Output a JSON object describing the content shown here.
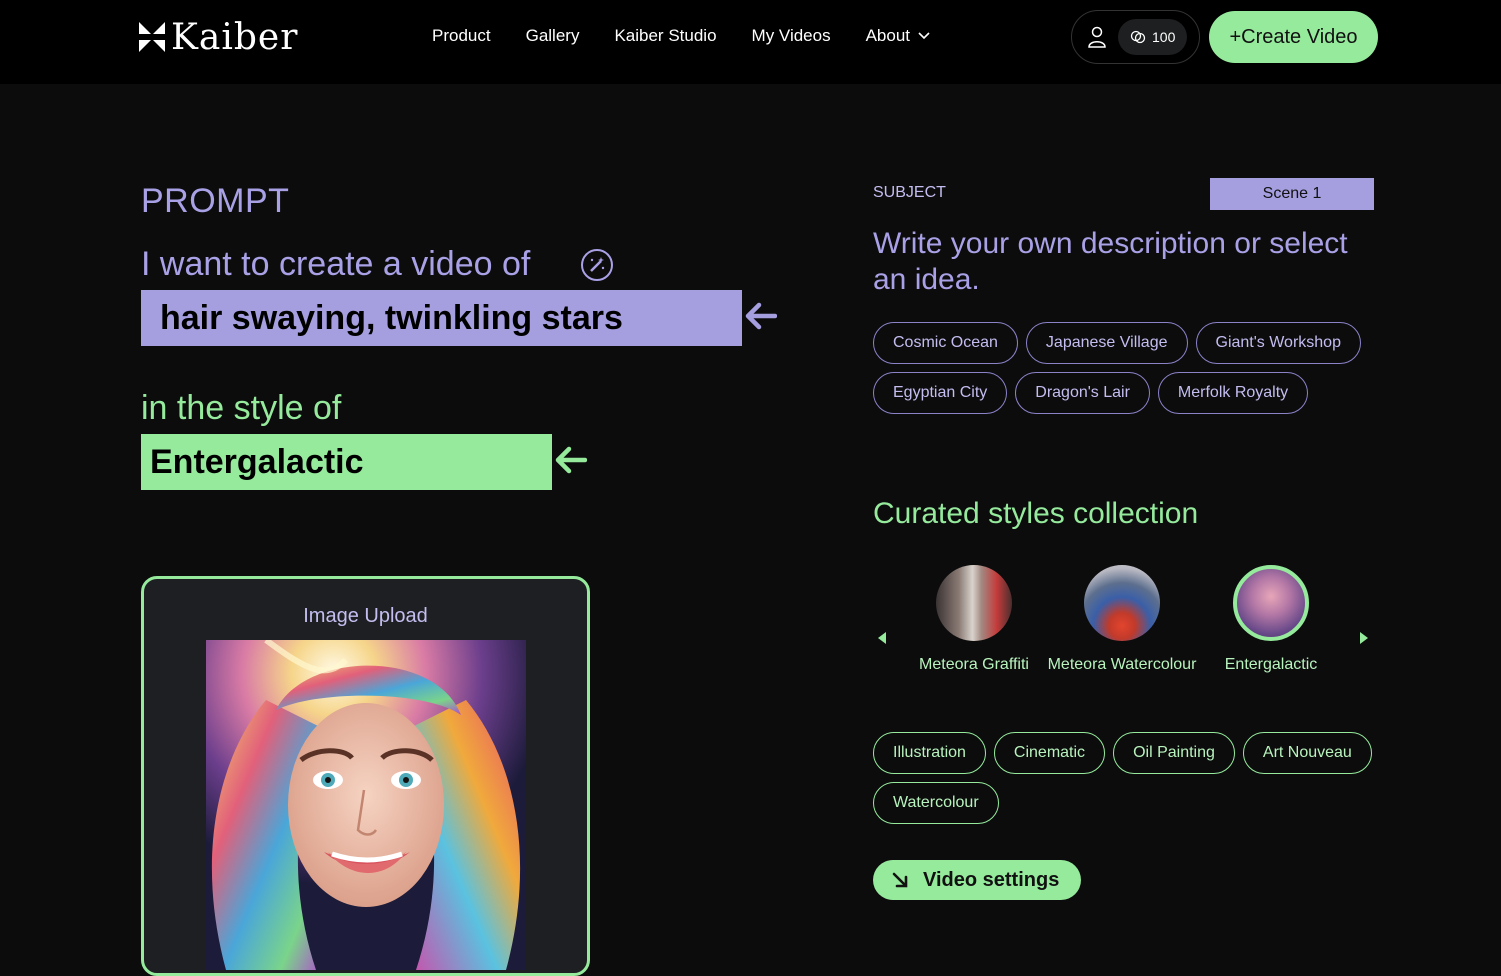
{
  "app": {
    "brand": "Kaiber",
    "accent_green": "#95ea9c",
    "accent_purple": "#a59fe0"
  },
  "nav": {
    "items": [
      "Product",
      "Gallery",
      "Kaiber Studio",
      "My Videos",
      "About"
    ],
    "credits": "100",
    "create_label": "+Create Video"
  },
  "prompt": {
    "heading": "PROMPT",
    "intro": "I want to create a video of",
    "subject_value": "hair swaying, twinkling stars",
    "style_intro": "in the style of",
    "style_value": "Entergalactic"
  },
  "upload": {
    "title": "Image Upload"
  },
  "subject_panel": {
    "label": "SUBJECT",
    "scene": "Scene 1",
    "instruction": "Write your own description or select an idea.",
    "ideas": [
      "Cosmic Ocean",
      "Japanese Village",
      "Giant's Workshop",
      "Egyptian City",
      "Dragon's Lair",
      "Merfolk Royalty"
    ]
  },
  "styles": {
    "heading": "Curated styles collection",
    "curated": [
      {
        "name": "Meteora Graffiti",
        "selected": false
      },
      {
        "name": "Meteora Watercolour",
        "selected": false
      },
      {
        "name": "Entergalactic",
        "selected": true
      }
    ],
    "chips": [
      "Illustration",
      "Cinematic",
      "Oil Painting",
      "Art Nouveau",
      "Watercolour"
    ]
  },
  "video_settings_label": "Video settings"
}
